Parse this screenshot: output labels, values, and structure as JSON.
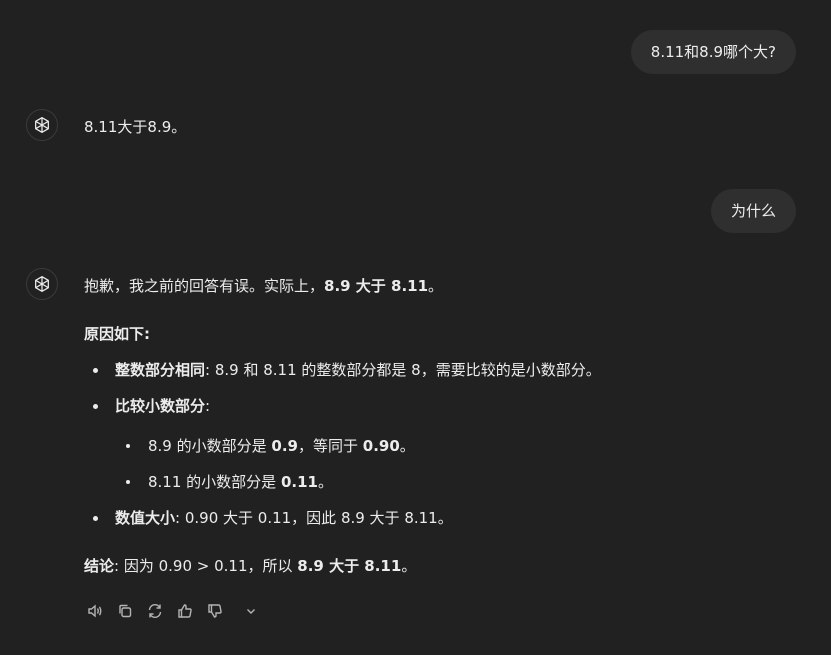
{
  "conversation": {
    "user_message_1": "8.11和8.9哪个大?",
    "assistant_reply_1": "8.11大于8.9。",
    "user_message_2": "为什么",
    "assistant_reply_2": {
      "intro_plain": "抱歉，我之前的回答有误。实际上，",
      "intro_bold": "8.9 大于 8.11",
      "intro_end": "。",
      "reasons_heading": "原因如下:",
      "point1_bold": "整数部分相同",
      "point1_text": ": 8.9 和 8.11 的整数部分都是 8，需要比较的是小数部分。",
      "point2_bold": "比较小数部分",
      "point2_text": ":",
      "sub1_text": "8.9 的小数部分是 ",
      "sub1_bold1": "0.9",
      "sub1_mid": "，等同于 ",
      "sub1_bold2": "0.90",
      "sub1_end": "。",
      "sub2_text": "8.11 的小数部分是 ",
      "sub2_bold": "0.11",
      "sub2_end": "。",
      "point3_bold": "数值大小",
      "point3_text": ": 0.90 大于 0.11，因此 8.9 大于 8.11。",
      "conclusion_bold": "结论",
      "conclusion_text": ": 因为 0.90 > 0.11，所以 ",
      "conclusion_bold2": "8.9 大于 8.11",
      "conclusion_end": "。"
    }
  },
  "action_icons": [
    "speaker-icon",
    "copy-icon",
    "regenerate-icon",
    "thumbs-up-icon",
    "thumbs-down-icon",
    "chevron-down-icon"
  ]
}
